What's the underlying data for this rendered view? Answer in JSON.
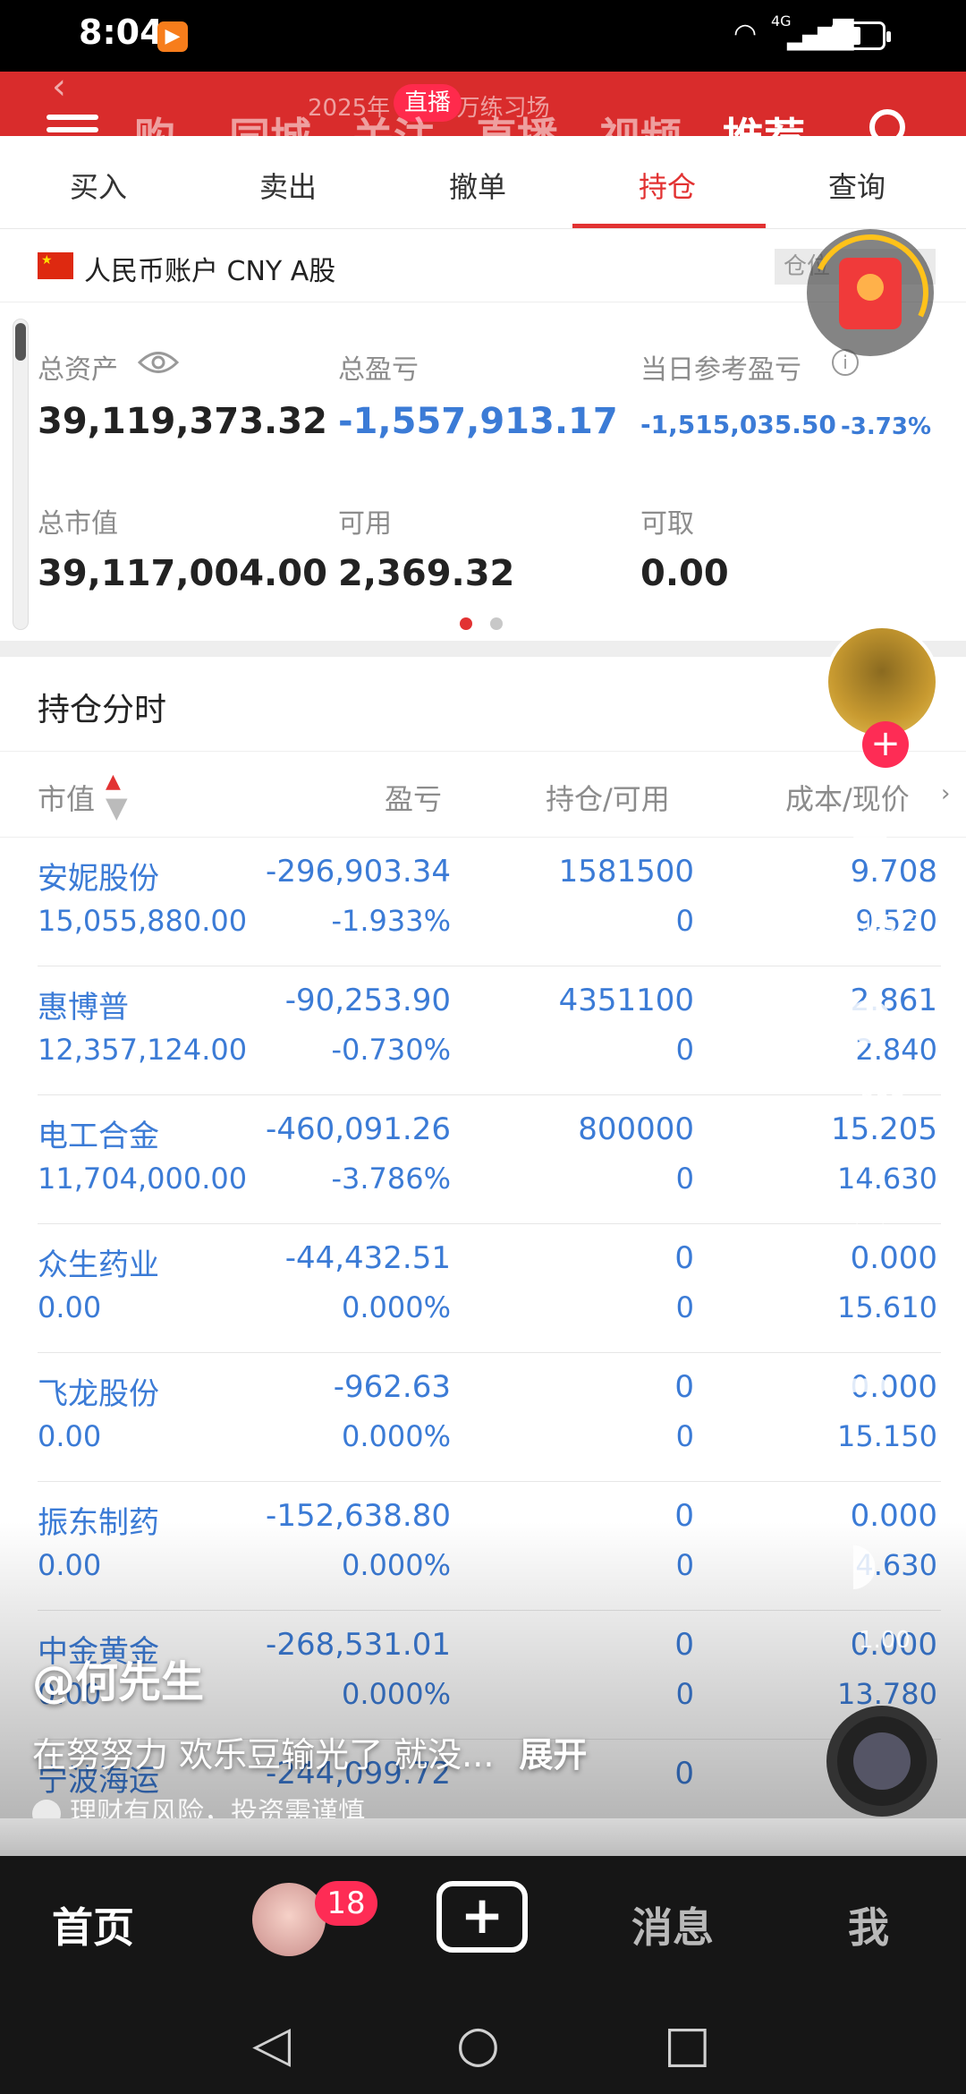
{
  "status_bar": {
    "time": "8:04",
    "net": "4G",
    "app_badge": "▶"
  },
  "video_overlay": {
    "top_nav": [
      "购",
      "同城",
      "关注",
      "直播",
      "视频",
      "推荐"
    ],
    "live_badge": "直播",
    "faded_title": "2025年    5000万练习场",
    "author": "@何先生",
    "description": "在努努力 欢乐豆输光了 就没...",
    "expand": "展开",
    "risk_note": "理财有风险，投资需谨慎",
    "side_counts": [
      "1.5万",
      "237",
      "14",
      "10",
      "1.00"
    ]
  },
  "trade_tabs": [
    "买入",
    "卖出",
    "撤单",
    "持仓",
    "查询"
  ],
  "account": {
    "label": "人民币账户 CNY A股",
    "position_label": "仓位"
  },
  "summary": {
    "total_assets_label": "总资产",
    "total_assets": "39,119,373.32",
    "total_pl_label": "总盈亏",
    "total_pl": "-1,557,913.17",
    "daily_pl_label": "当日参考盈亏",
    "daily_pl": "-1,515,035.50",
    "daily_pl_pct": "-3.73%",
    "market_value_label": "总市值",
    "market_value": "39,117,004.00",
    "available_label": "可用",
    "available": "2,369.32",
    "withdrawable_label": "可取",
    "withdrawable": "0.00"
  },
  "holdings_title": "持仓分时",
  "table_headers": {
    "market_value": "市值",
    "pl": "盈亏",
    "holding": "持仓/可用",
    "cost": "成本/现价"
  },
  "holdings": [
    {
      "name": "安妮股份",
      "market_value": "15,055,880.00",
      "pl": "-296,903.34",
      "pl_pct": "-1.933%",
      "holding": "1581500",
      "available": "0",
      "cost": "9.708",
      "price": "9.520"
    },
    {
      "name": "惠博普",
      "market_value": "12,357,124.00",
      "pl": "-90,253.90",
      "pl_pct": "-0.730%",
      "holding": "4351100",
      "available": "0",
      "cost": "2.861",
      "price": "2.840"
    },
    {
      "name": "电工合金",
      "market_value": "11,704,000.00",
      "pl": "-460,091.26",
      "pl_pct": "-3.786%",
      "holding": "800000",
      "available": "0",
      "cost": "15.205",
      "price": "14.630"
    },
    {
      "name": "众生药业",
      "market_value": "0.00",
      "pl": "-44,432.51",
      "pl_pct": "0.000%",
      "holding": "0",
      "available": "0",
      "cost": "0.000",
      "price": "15.610"
    },
    {
      "name": "飞龙股份",
      "market_value": "0.00",
      "pl": "-962.63",
      "pl_pct": "0.000%",
      "holding": "0",
      "available": "0",
      "cost": "0.000",
      "price": "15.150"
    },
    {
      "name": "振东制药",
      "market_value": "0.00",
      "pl": "-152,638.80",
      "pl_pct": "0.000%",
      "holding": "0",
      "available": "0",
      "cost": "0.000",
      "price": "4.630"
    },
    {
      "name": "中金黄金",
      "market_value": "0.00",
      "pl": "-268,531.01",
      "pl_pct": "0.000%",
      "holding": "0",
      "available": "0",
      "cost": "0.000",
      "price": "13.780"
    },
    {
      "name": "宁波海运",
      "market_value": "",
      "pl": "-244,099.72",
      "pl_pct": "",
      "holding": "0",
      "available": "",
      "cost": "",
      "price": ""
    }
  ],
  "bottom_nav": {
    "home": "首页",
    "messages": "消息",
    "me": "我",
    "friends_badge": "18",
    "add": "+"
  },
  "colors": {
    "red": "#e23232",
    "blue": "#3b7bd6",
    "header_red": "#d92c2c"
  }
}
